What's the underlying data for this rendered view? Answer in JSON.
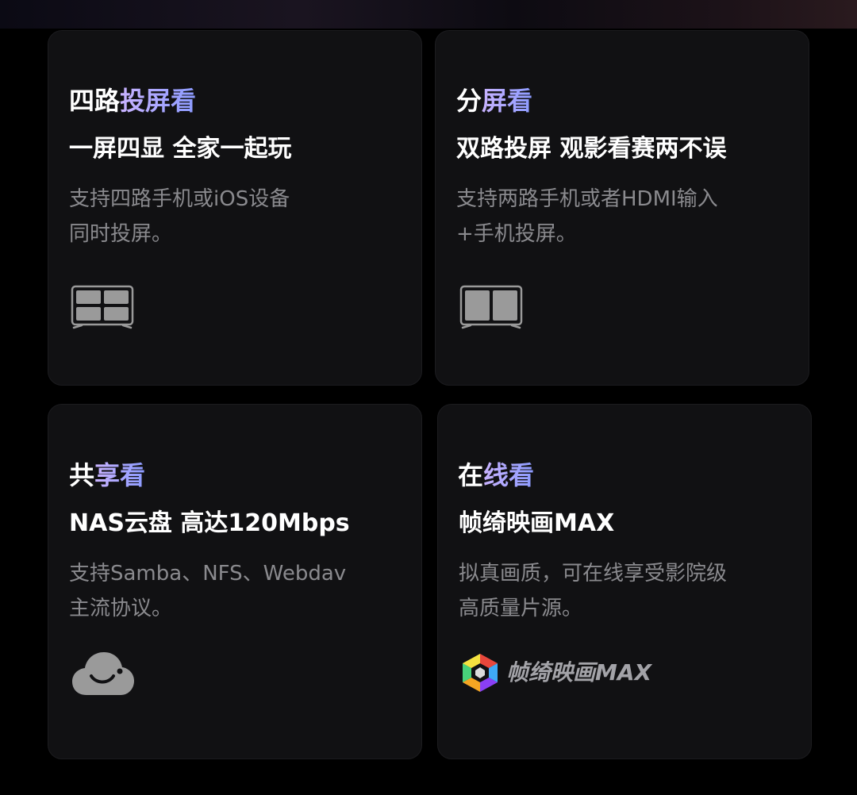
{
  "cards": [
    {
      "title_a": "四路",
      "title_b": "投屏看",
      "headline": "一屏四显 全家一起玩",
      "desc_line1": "支持四路手机或iOS设备",
      "desc_line2": "同时投屏。",
      "icon": "quad-screen-tv-icon"
    },
    {
      "title_a": "分",
      "title_b": "屏看",
      "headline": "双路投屏 观影看赛两不误",
      "desc_line1": "支持两路手机或者HDMI输入",
      "desc_line2": "+手机投屏。",
      "icon": "split-screen-tv-icon"
    },
    {
      "title_a": "共",
      "title_b": "享看",
      "headline": "NAS云盘 高达120Mbps",
      "desc_line1": "支持Samba、NFS、Webdav",
      "desc_line2": "主流协议。",
      "icon": "cloud-icon"
    },
    {
      "title_a": "在",
      "title_b": "线看",
      "headline": "帧绮映画MAX",
      "desc_line1": "拟真画质，可在线享受影院级",
      "desc_line2": "高质量片源。",
      "icon": "brand-logo-icon",
      "logo_text": "帧绮映画MAX"
    }
  ],
  "colors": {
    "background": "#000000",
    "card": "#111113",
    "title_gradient_start": "#c9b3ff",
    "title_gradient_end": "#8c9bff",
    "desc": "#8a8a8e",
    "icon": "#9a9a9a"
  }
}
